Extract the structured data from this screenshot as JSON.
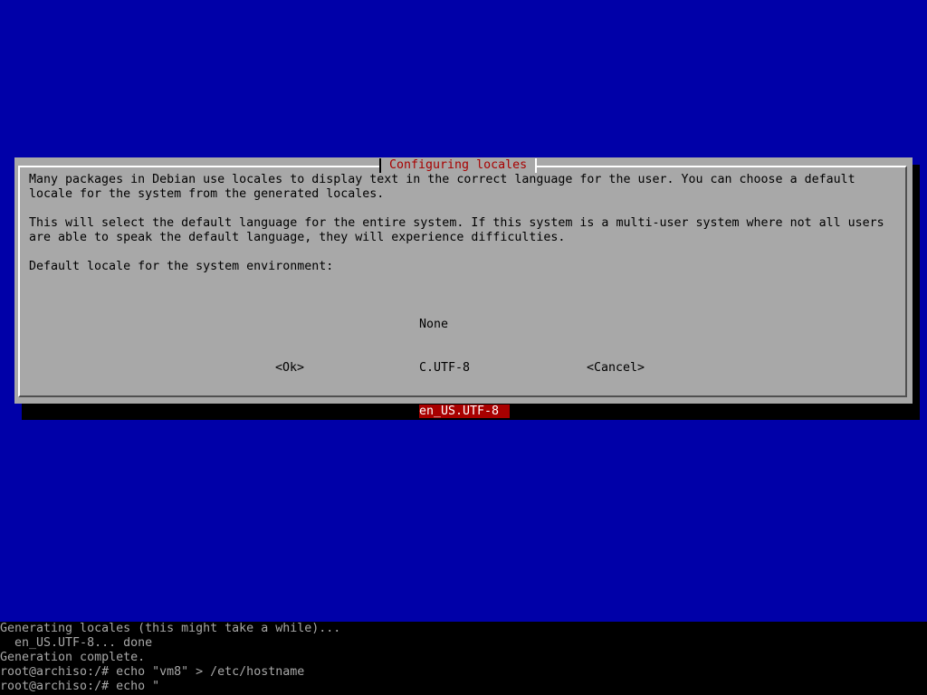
{
  "dialog": {
    "title": "Configuring locales",
    "paragraphs": [
      "Many packages in Debian use locales to display text in the correct language for the user. You can choose a default",
      "locale for the system from the generated locales.",
      "This will select the default language for the entire system. If this system is a multi-user system where not all users",
      "are able to speak the default language, they will experience difficulties.",
      "Default locale for the system environment:"
    ],
    "options": [
      "None",
      "C.UTF-8",
      "en_US.UTF-8"
    ],
    "selected_option": "en_US.UTF-8",
    "ok_label": "<Ok>",
    "cancel_label": "<Cancel>"
  },
  "terminal": {
    "lines": [
      "Generating locales (this might take a while)...",
      "  en_US.UTF-8... done",
      "Generation complete.",
      "root@archiso:/# echo \"vm8\" > /etc/hostname",
      "root@archiso:/# echo \""
    ]
  },
  "colors": {
    "background": "#0000a8",
    "dialog": "#a8a8a8",
    "title": "#a80000",
    "selection": "#a80000",
    "terminal": "#000000"
  }
}
